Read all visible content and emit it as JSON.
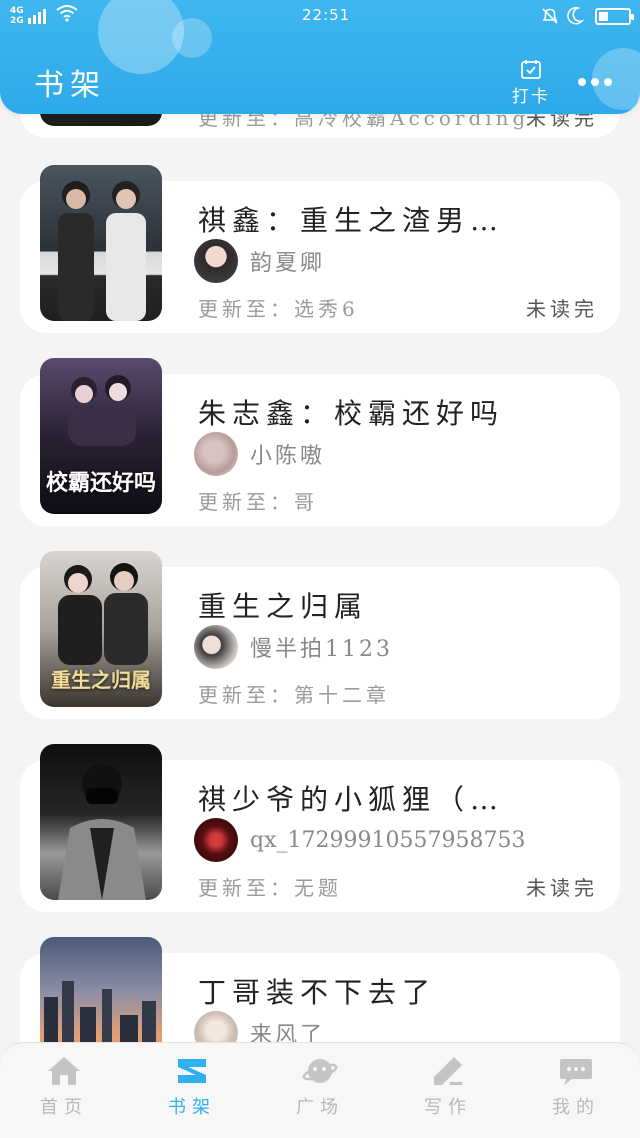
{
  "status_bar": {
    "network": "4G\n2G",
    "time": "22:51"
  },
  "header": {
    "title": "书架",
    "checkin_label": "打卡"
  },
  "books": [
    {
      "title": "",
      "author": "",
      "update_prefix": "更新至：",
      "latest": "高冷校霸According",
      "unread_label": "未读完",
      "cover_text": ""
    },
    {
      "title": "祺鑫：重生之渣男…",
      "author": "韵夏卿",
      "update_prefix": "更新至：",
      "latest": "选秀6",
      "unread_label": "未读完",
      "cover_text": ""
    },
    {
      "title": "朱志鑫：校霸还好吗",
      "author": "小陈嗷",
      "update_prefix": "更新至：",
      "latest": "哥",
      "unread_label": "",
      "cover_text": "校霸还好吗"
    },
    {
      "title": "重生之归属",
      "author": "慢半拍1123",
      "update_prefix": "更新至：",
      "latest": "第十二章",
      "unread_label": "",
      "cover_text": "重生之归属"
    },
    {
      "title": "祺少爷的小狐狸（…",
      "author": "qx_17299910557958753",
      "update_prefix": "更新至：",
      "latest": "无题",
      "unread_label": "未读完",
      "cover_text": ""
    },
    {
      "title": "丁哥装不下去了",
      "author": "来风了",
      "update_prefix": "",
      "latest": "",
      "unread_label": "",
      "cover_text": ""
    }
  ],
  "nav": [
    {
      "label": "首页",
      "icon": "home-icon"
    },
    {
      "label": "书架",
      "icon": "bookshelf-icon"
    },
    {
      "label": "广场",
      "icon": "planet-icon"
    },
    {
      "label": "写作",
      "icon": "pen-icon"
    },
    {
      "label": "我的",
      "icon": "chat-bubble-icon"
    }
  ],
  "colors": {
    "accent": "#2fb0f0",
    "header": "#3fb6ee",
    "inactive": "#b8b8b8"
  }
}
